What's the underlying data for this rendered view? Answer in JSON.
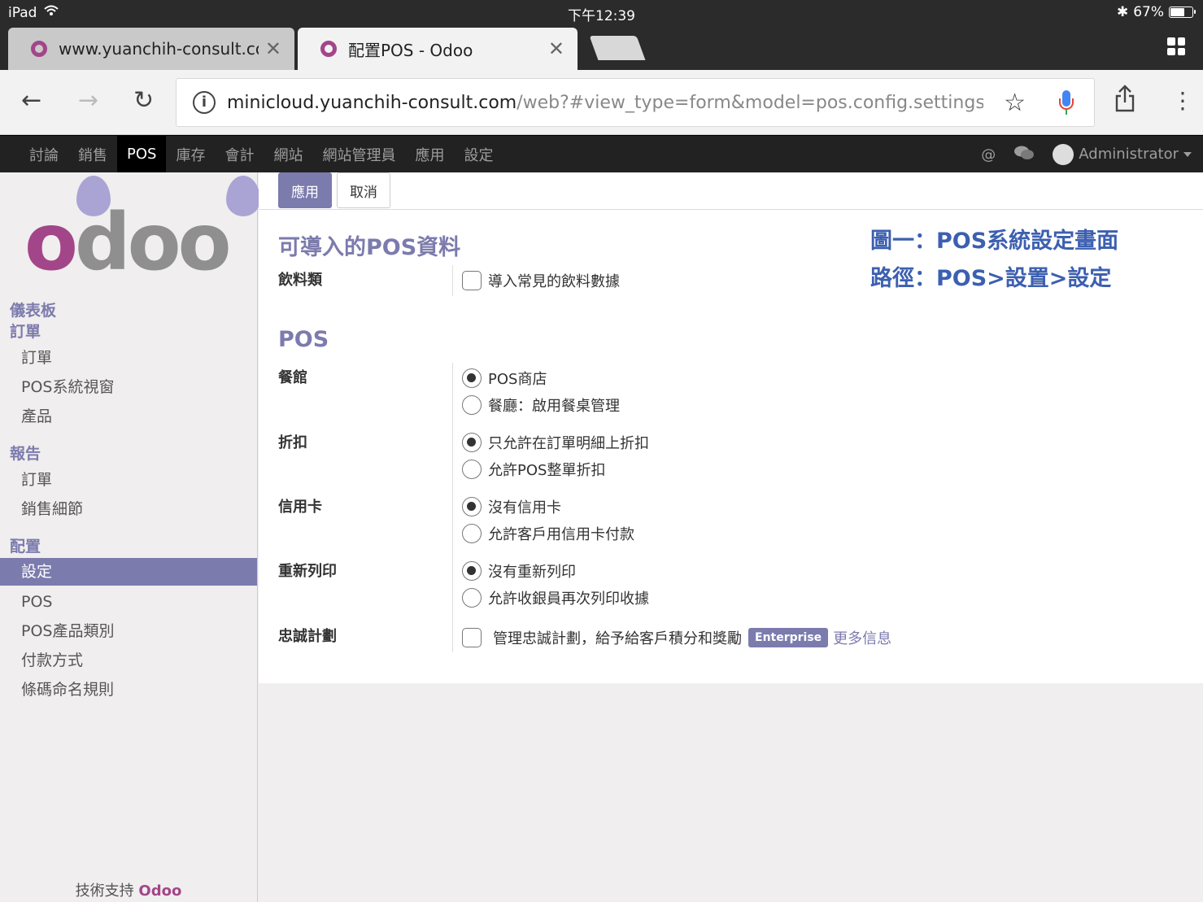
{
  "statusbar": {
    "device": "iPad",
    "time": "下午12:39",
    "battery": "67%",
    "battery_level": 0.67
  },
  "browser": {
    "tabs": [
      {
        "title": "www.yuanchih-consult.com"
      },
      {
        "title": "配置POS - Odoo"
      }
    ],
    "url_host": "minicloud.yuanchih-consult.com",
    "url_path": "/web?#view_type=form&model=pos.config.settings&menu"
  },
  "topmenu": {
    "items": [
      "討論",
      "銷售",
      "POS",
      "庫存",
      "會計",
      "網站",
      "網站管理員",
      "應用",
      "設定"
    ],
    "active_index": 2,
    "user": "Administrator"
  },
  "sidebar": {
    "dashboard": "儀表板",
    "orders_section": "訂單",
    "orders_items": [
      "訂單",
      "POS系統視窗",
      "產品"
    ],
    "reports_section": "報告",
    "reports_items": [
      "訂單",
      "銷售細節"
    ],
    "config_section": "配置",
    "config_items": [
      "設定",
      "POS",
      "POS產品類別",
      "付款方式",
      "條碼命名規則"
    ],
    "powered_prefix": "技術支持",
    "powered_brand": "Odoo"
  },
  "controlpanel": {
    "apply": "應用",
    "cancel": "取消"
  },
  "form": {
    "section_import": "可導入的POS資料",
    "beverage_label": "飲料類",
    "beverage_option": "導入常見的飲料數據",
    "section_pos": "POS",
    "restaurant_label": "餐館",
    "restaurant_opt1": "POS商店",
    "restaurant_opt2": "餐廳：啟用餐桌管理",
    "discount_label": "折扣",
    "discount_opt1": "只允許在訂單明細上折扣",
    "discount_opt2": "允許POS整單折扣",
    "card_label": "信用卡",
    "card_opt1": "沒有信用卡",
    "card_opt2": "允許客戶用信用卡付款",
    "reprint_label": "重新列印",
    "reprint_opt1": "沒有重新列印",
    "reprint_opt2": "允許收銀員再次列印收據",
    "loyalty_label": "忠誠計劃",
    "loyalty_option": "管理忠誠計劃，給予給客戶積分和獎勵",
    "enterprise_badge": "Enterprise",
    "more_info": "更多信息"
  },
  "annotation": {
    "line1": "圖一：POS系統設定畫面",
    "line2": "路徑：POS>設置>設定"
  }
}
